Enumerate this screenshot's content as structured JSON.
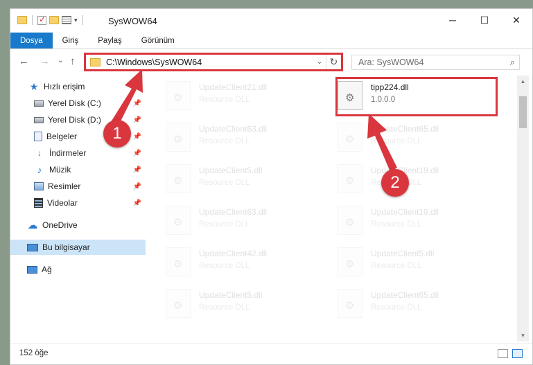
{
  "window": {
    "title": "SysWOW64",
    "controls": {
      "minimize": "─",
      "maximize": "☐",
      "close": "✕"
    }
  },
  "ribbon": {
    "tabs": [
      {
        "label": "Dosya",
        "active": true
      },
      {
        "label": "Giriş"
      },
      {
        "label": "Paylaş"
      },
      {
        "label": "Görünüm"
      }
    ]
  },
  "nav": {
    "back": "←",
    "forward": "→",
    "recent": "⌄",
    "up": "↑",
    "address": "C:\\Windows\\SysWOW64",
    "address_dropdown": "⌄",
    "refresh": "↻",
    "search_placeholder": "Ara: SysWOW64",
    "search_icon": "⌕"
  },
  "sidebar": {
    "items": [
      {
        "label": "Hızlı erişim",
        "icon": "star-icon"
      },
      {
        "label": "Yerel Disk (C:)",
        "icon": "drive-icon",
        "pinned": true
      },
      {
        "label": "Yerel Disk (D:)",
        "icon": "drive-icon",
        "pinned": true
      },
      {
        "label": "Belgeler",
        "icon": "documents-icon",
        "pinned": true
      },
      {
        "label": "İndirmeler",
        "icon": "download-icon",
        "pinned": true
      },
      {
        "label": "Müzik",
        "icon": "music-icon",
        "pinned": true
      },
      {
        "label": "Resimler",
        "icon": "pictures-icon",
        "pinned": true
      },
      {
        "label": "Videolar",
        "icon": "videos-icon",
        "pinned": true
      },
      {
        "label": "OneDrive",
        "icon": "cloud-icon"
      },
      {
        "label": "Bu bilgisayar",
        "icon": "computer-icon",
        "selected": true
      },
      {
        "label": "Ağ",
        "icon": "network-icon"
      }
    ]
  },
  "files": [
    {
      "name": "UpdateClient21.dll",
      "type": "Resource DLL"
    },
    {
      "name": "tipp224.dll",
      "type": "1.0.0.0",
      "highlighted": true
    },
    {
      "name": "UpdateClient63.dll",
      "type": "Resource DLL"
    },
    {
      "name": "UpdateClient65.dll",
      "type": "Resource DLL"
    },
    {
      "name": "UpdateClient5.dll",
      "type": "Resource DLL"
    },
    {
      "name": "UpdateClient19.dll",
      "type": "Resource DLL"
    },
    {
      "name": "UpdateClient63.dll",
      "type": "Resource DLL"
    },
    {
      "name": "UpdateClient19.dll",
      "type": "Resource DLL"
    },
    {
      "name": "UpdateClient42.dll",
      "type": "Resource DLL"
    },
    {
      "name": "UpdateClient5.dll",
      "type": "Resource DLL"
    },
    {
      "name": "UpdateClient5.dll",
      "type": "Resource DLL"
    },
    {
      "name": "UpdateClient65.dll",
      "type": "Resource DLL"
    }
  ],
  "status": {
    "item_count": "152 öğe"
  },
  "annotations": {
    "step1": "1",
    "step2": "2",
    "color": "#d9363e"
  },
  "colors": {
    "accent": "#1979ca",
    "selected": "#cce4f7",
    "highlight": "#d9363e"
  }
}
